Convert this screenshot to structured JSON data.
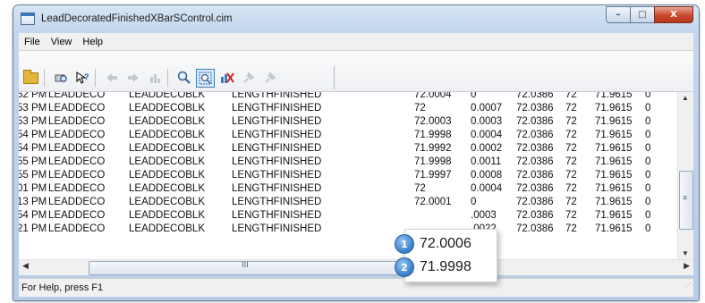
{
  "window": {
    "title": "LeadDecoratedFinishedXBarSControl.cim",
    "buttons": {
      "minimize": "–",
      "maximize": "□",
      "close": "X"
    }
  },
  "menu": [
    "File",
    "View",
    "Help"
  ],
  "toolbar": {
    "icons": [
      "open-icon",
      "print-preview-icon",
      "context-help-icon",
      "back-icon",
      "forward-icon",
      "home-icon",
      "zoom-icon",
      "zoom-rect-icon",
      "chart-delete-icon",
      "pin-icon",
      "pin-alt-icon"
    ]
  },
  "table": {
    "rows": [
      [
        "52 PM",
        "LEADDECO",
        "LEADDECOBLK",
        "LENGTHFINISHED",
        "72.0004",
        "0",
        "72.0386",
        "72",
        "71.9615",
        "0"
      ],
      [
        "53 PM",
        "LEADDECO",
        "LEADDECOBLK",
        "LENGTHFINISHED",
        "72",
        "0.0007",
        "72.0386",
        "72",
        "71.9615",
        "0"
      ],
      [
        "53 PM",
        "LEADDECO",
        "LEADDECOBLK",
        "LENGTHFINISHED",
        "72.0003",
        "0.0003",
        "72.0386",
        "72",
        "71.9615",
        "0"
      ],
      [
        "54 PM",
        "LEADDECO",
        "LEADDECOBLK",
        "LENGTHFINISHED",
        "71.9998",
        "0.0004",
        "72.0386",
        "72",
        "71.9615",
        "0"
      ],
      [
        "54 PM",
        "LEADDECO",
        "LEADDECOBLK",
        "LENGTHFINISHED",
        "71.9992",
        "0.0002",
        "72.0386",
        "72",
        "71.9615",
        "0"
      ],
      [
        "55 PM",
        "LEADDECO",
        "LEADDECOBLK",
        "LENGTHFINISHED",
        "71.9998",
        "0.0011",
        "72.0386",
        "72",
        "71.9615",
        "0"
      ],
      [
        "55 PM",
        "LEADDECO",
        "LEADDECOBLK",
        "LENGTHFINISHED",
        "71.9997",
        "0.0008",
        "72.0386",
        "72",
        "71.9615",
        "0"
      ],
      [
        "01 PM",
        "LEADDECO",
        "LEADDECOBLK",
        "LENGTHFINISHED",
        "72",
        "0.0004",
        "72.0386",
        "72",
        "71.9615",
        "0"
      ],
      [
        "13 PM",
        "LEADDECO",
        "LEADDECOBLK",
        "LENGTHFINISHED",
        "72.0001",
        "0",
        "72.0386",
        "72",
        "71.9615",
        "0"
      ],
      [
        "54 PM",
        "LEADDECO",
        "LEADDECOBLK",
        "LENGTHFINISHED",
        "",
        ".0003",
        "72.0386",
        "72",
        "71.9615",
        "0"
      ],
      [
        "21 PM",
        "LEADDECO",
        "LEADDECOBLK",
        "LENGTHFINISHED",
        "",
        ".0022",
        "72.0386",
        "72",
        "71.9615",
        "0"
      ]
    ]
  },
  "scrollbar": {
    "grip": "III"
  },
  "callout": {
    "items": [
      {
        "badge": "1",
        "value": "72.0006"
      },
      {
        "badge": "2",
        "value": "71.9998"
      }
    ]
  },
  "status": {
    "text": "For Help, press F1"
  }
}
